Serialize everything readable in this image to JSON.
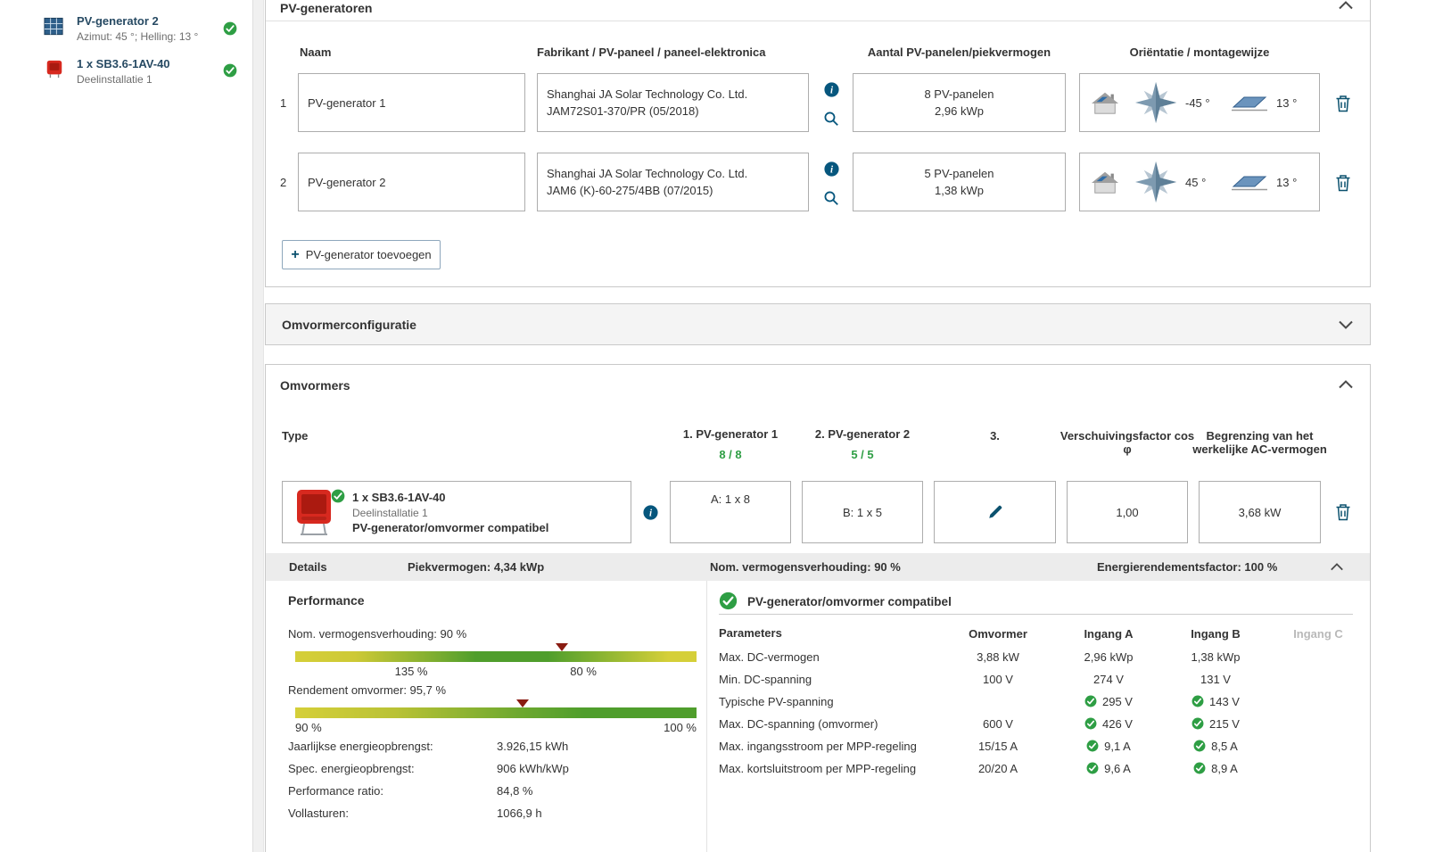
{
  "sidebar": {
    "items": [
      {
        "title": "PV-generator 2",
        "subtitle": "Azimut: 45 °; Helling: 13 °"
      },
      {
        "title": "1 x SB3.6-1AV-40",
        "subtitle": "Deelinstallatie 1"
      }
    ]
  },
  "pv": {
    "title": "PV-generatoren",
    "col_naam": "Naam",
    "col_fabrikant": "Fabrikant / PV-paneel / paneel-elektronica",
    "col_aantal": "Aantal PV-panelen/piekvermogen",
    "col_orientatie": "Oriëntatie / montagewijze",
    "rows": [
      {
        "index": "1",
        "name": "PV-generator 1",
        "manufacturer": "Shanghai JA Solar Technology Co. Ltd.",
        "panel": "JAM72S01-370/PR (05/2018)",
        "count": "8 PV-panelen",
        "power": "2,96 kWp",
        "azimuth": "-45 °",
        "tilt": "13 °"
      },
      {
        "index": "2",
        "name": "PV-generator 2",
        "manufacturer": "Shanghai JA Solar Technology Co. Ltd.",
        "panel": "JAM6 (K)-60-275/4BB (07/2015)",
        "count": "5 PV-panelen",
        "power": "1,38 kWp",
        "azimuth": "45 °",
        "tilt": "13 °"
      }
    ],
    "add_plus": "+",
    "add_label": "PV-generator toevoegen"
  },
  "config": {
    "title": "Omvormerconfiguratie"
  },
  "inverters": {
    "title": "Omvormers",
    "col_type": "Type",
    "col_gen1": "1. PV-generator 1",
    "gen1_count": "8 / 8",
    "col_gen2": "2. PV-generator 2",
    "gen2_count": "5 / 5",
    "col_gen3": "3.",
    "col_cos": "Verschuivingsfactor cos φ",
    "col_limit": "Begrenzing van het werkelijke AC-vermogen",
    "row": {
      "name": "1 x SB3.6-1AV-40",
      "subtitle": "Deelinstallatie 1",
      "compat": "PV-generator/omvormer compatibel",
      "input_a": "A: 1 x 8",
      "input_b": "B: 1 x 5",
      "cos": "1,00",
      "ac_limit": "3,68 kW"
    },
    "details_bar": {
      "details": "Details",
      "piek": "Piekvermogen: 4,34 kWp",
      "nom": "Nom. vermogensverhouding: 90 %",
      "energie": "Energierendementsfactor: 100 %"
    }
  },
  "performance": {
    "title": "Performance",
    "bar1": {
      "label": "Nom. vermogensverhouding: 90 %",
      "marker_left": "66.4%",
      "tick1": "135 %",
      "tick1_left": "28.9%",
      "tick2": "80 %",
      "tick2_left": "71.8%"
    },
    "bar2": {
      "label": "Rendement omvormer: 95,7 %",
      "marker_left": "56.7%",
      "tick_left": "90 %",
      "tick_right": "100 %"
    },
    "kv": [
      {
        "label": "Jaarlijkse energieopbrengst:",
        "value": "3.926,15 kWh"
      },
      {
        "label": "Spec. energieopbrengst:",
        "value": "906 kWh/kWp"
      },
      {
        "label": "Performance ratio:",
        "value": "84,8 %"
      },
      {
        "label": "Vollasturen:",
        "value": "1066,9 h"
      }
    ]
  },
  "compat": {
    "title": "PV-generator/omvormer compatibel",
    "col_parameters": "Parameters",
    "col_omvormer": "Omvormer",
    "col_a": "Ingang A",
    "col_b": "Ingang B",
    "col_c": "Ingang C",
    "rows": [
      {
        "label": "Max. DC-vermogen",
        "omv": "3,88 kW",
        "a": "2,96 kWp",
        "b": "1,38 kWp"
      },
      {
        "label": "Min. DC-spanning",
        "omv": "100 V",
        "a": "274 V",
        "b": "131 V"
      },
      {
        "label": "Typische PV-spanning",
        "omv": "",
        "a": "295 V",
        "b": "143 V"
      },
      {
        "label": "Max. DC-spanning (omvormer)",
        "omv": "600 V",
        "a": "426 V",
        "b": "215 V"
      },
      {
        "label": "Max. ingangsstroom per MPP-regeling",
        "omv": "15/15 A",
        "a": "9,1 A",
        "b": "8,5 A"
      },
      {
        "label": "Max. kortsluitstroom per MPP-regeling",
        "omv": "20/20 A",
        "a": "9,6 A",
        "b": "8,9 A"
      }
    ]
  },
  "colors": {
    "accent_green": "#2e9e44",
    "accent_blue": "#0b516e",
    "brand_red": "#d7291f"
  }
}
